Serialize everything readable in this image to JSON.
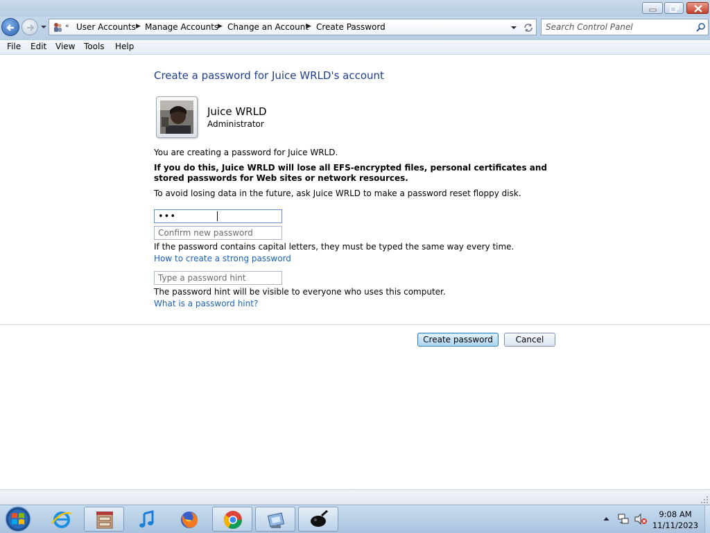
{
  "breadcrumb": {
    "items": [
      "User Accounts",
      "Manage Accounts",
      "Change an Account",
      "Create Password"
    ]
  },
  "search": {
    "placeholder": "Search Control Panel"
  },
  "menu": {
    "items": [
      "File",
      "Edit",
      "View",
      "Tools",
      "Help"
    ]
  },
  "page": {
    "title": "Create a password for Juice WRLD's account",
    "user_name": "Juice WRLD",
    "user_role": "Administrator",
    "info_line": "You are creating a password for Juice WRLD.",
    "warning": "If you do this, Juice WRLD will lose all EFS-encrypted files, personal certificates and stored passwords for Web sites or network resources.",
    "advice": "To avoid losing data in the future, ask Juice WRLD to make a password reset floppy disk.",
    "new_password_value": "•••",
    "confirm_placeholder": "Confirm new password",
    "caps_note": "If the password contains capital letters, they must be typed the same way every time.",
    "strong_link": "How to create a strong password",
    "hint_placeholder": "Type a password hint",
    "hint_note": "The password hint will be visible to everyone who uses this computer.",
    "hint_link": "What is a password hint?",
    "create_button": "Create password",
    "cancel_button": "Cancel"
  },
  "taskbar": {
    "apps": [
      "file-cabinet-icon",
      "itunes-icon",
      "firefox-icon",
      "chrome-icon",
      "control-panel-icon",
      "app-icon"
    ],
    "time": "9:08 AM",
    "date": "11/11/2023"
  },
  "colors": {
    "heading": "#1e3d8f",
    "link": "#1b62b8",
    "taskbar": "#a9c3de"
  }
}
